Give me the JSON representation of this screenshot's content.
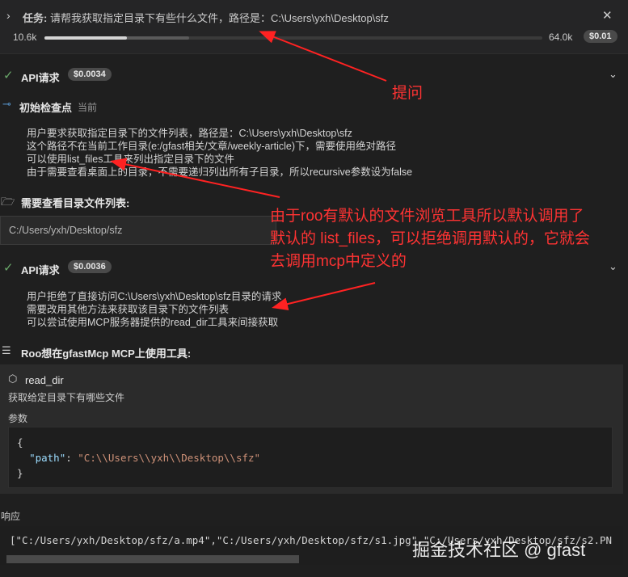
{
  "task": {
    "label": "任务:",
    "text": "请帮我获取指定目录下有些什么文件，路径是：C:\\Users\\yxh\\Desktop\\sfz",
    "tokens_in": "10.6k",
    "tokens_max": "64.0k",
    "cost": "$0.01",
    "progress_fill_fraction": 0.166,
    "progress_mid_fraction": 0.29,
    "close_icon": "close-icon"
  },
  "api1": {
    "label": "API请求",
    "cost": "$0.0034"
  },
  "checkpoint": {
    "label": "初始检查点",
    "status": "当前"
  },
  "reasoning1": [
    "用户要求获取指定目录下的文件列表，路径是：C:\\Users\\yxh\\Desktop\\sfz",
    "这个路径不在当前工作目录(e:/gfast相关/文章/weekly-article)下，需要使用绝对路径",
    "可以使用list_files工具来列出指定目录下的文件",
    "由于需要查看桌面上的目录，不需要递归列出所有子目录，所以recursive参数设为false"
  ],
  "list_tool": {
    "label": "需要查看目录文件列表:",
    "path": "C:/Users/yxh/Desktop/sfz"
  },
  "api2": {
    "label": "API请求",
    "cost": "$0.0036"
  },
  "reasoning2": [
    "用户拒绝了直接访问C:\\Users\\yxh\\Desktop\\sfz目录的请求",
    "需要改用其他方法来获取该目录下的文件列表",
    "可以尝试使用MCP服务器提供的read_dir工具来间接获取"
  ],
  "mcp": {
    "label": "Roo想在gfastMcp MCP上使用工具:",
    "tool_name": "read_dir",
    "tool_desc": "获取给定目录下有哪些文件",
    "params_label": "参数",
    "code_open": "{",
    "code_key": "\"path\"",
    "code_sep": ": ",
    "code_val": "\"C:\\\\Users\\\\yxh\\\\Desktop\\\\sfz\"",
    "code_close": "}"
  },
  "response": {
    "label": "响应",
    "text": "[\"C:/Users/yxh/Desktop/sfz/a.mp4\",\"C:/Users/yxh/Desktop/sfz/s1.jpg\",\"C:/Users/yxh/Desktop/sfz/s2.PN"
  },
  "annotations": {
    "note1": "提问",
    "note2_line1": "由于roo有默认的文件浏览工具所以默认调用了",
    "note2_line2": "默认的 list_files，可以拒绝调用默认的，它就会",
    "note2_line3": "去调用mcp中定义的"
  },
  "watermark": "掘金技术社区 @ gfast",
  "colors": {
    "annotation": "#ff3333",
    "check": "#6aa96a",
    "background": "#1f1f1f"
  }
}
